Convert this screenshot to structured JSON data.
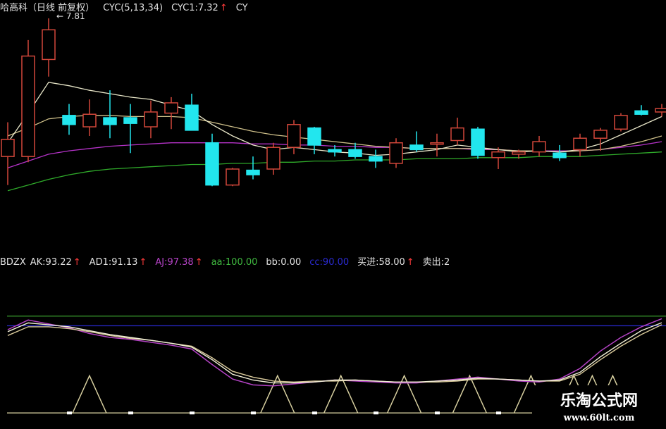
{
  "colors": {
    "background": "#000000",
    "up_candle": "#d2473a",
    "down_candle": "#22e6ee",
    "ma_fast": "#e8e6c8",
    "ma_mid": "#cfc08a",
    "ma_slow": "#b532c8",
    "ma_long": "#2faa2a",
    "ak_line": "#f2f0d8",
    "ad1_line": "#d8c99a",
    "aj_line": "#b543c6",
    "level_green": "#3aa02e",
    "level_blue": "#2a2ad0",
    "level_bottom": "#d8d0a0",
    "white_text": "#e0e0e0",
    "arrow": "#ff3b3b"
  },
  "top_header": {
    "title": "哈高科（日线 前复权）",
    "cyc_params": "CYC(5,13,34)",
    "cyc1": "CYC1:7.32",
    "cyc1_arrow": "↑",
    "cyc_trunc": "CY"
  },
  "price_annotation": "7.81",
  "indicator_header": {
    "name": "BDZX",
    "ak": "AK:93.22",
    "ak_arrow": "↑",
    "ad1": "AD1:91.13",
    "ad1_arrow": "↑",
    "aj": "AJ:97.38",
    "aj_arrow": "↑",
    "aa": "aa:100.00",
    "bb": "bb:0.00",
    "cc": "cc:90.00",
    "buy": "买进:58.00",
    "buy_arrow": "↑",
    "sell": "卖出:2"
  },
  "watermark": {
    "title": "乐淘公式网",
    "url": "www.60lt.com"
  },
  "chart_data": {
    "type": "candlestick",
    "candles": [
      {
        "o": 6.6,
        "h": 6.9,
        "l": 6.35,
        "c": 6.75
      },
      {
        "o": 6.6,
        "h": 7.62,
        "l": 6.55,
        "c": 7.48
      },
      {
        "o": 7.45,
        "h": 7.81,
        "l": 7.3,
        "c": 7.71
      },
      {
        "o": 6.96,
        "h": 7.06,
        "l": 6.79,
        "c": 6.88
      },
      {
        "o": 6.86,
        "h": 7.1,
        "l": 6.78,
        "c": 6.97
      },
      {
        "o": 6.94,
        "h": 7.18,
        "l": 6.76,
        "c": 6.88
      },
      {
        "o": 6.94,
        "h": 7.06,
        "l": 6.63,
        "c": 6.89
      },
      {
        "o": 6.86,
        "h": 7.09,
        "l": 6.76,
        "c": 6.99
      },
      {
        "o": 6.98,
        "h": 7.12,
        "l": 6.84,
        "c": 7.07
      },
      {
        "o": 7.05,
        "h": 7.15,
        "l": 6.88,
        "c": 6.83
      },
      {
        "o": 6.72,
        "h": 6.8,
        "l": 6.34,
        "c": 6.35
      },
      {
        "o": 6.35,
        "h": 6.5,
        "l": 6.34,
        "c": 6.49
      },
      {
        "o": 6.48,
        "h": 6.6,
        "l": 6.4,
        "c": 6.44
      },
      {
        "o": 6.49,
        "h": 6.72,
        "l": 6.44,
        "c": 6.68
      },
      {
        "o": 6.68,
        "h": 6.92,
        "l": 6.62,
        "c": 6.88
      },
      {
        "o": 6.85,
        "h": 6.86,
        "l": 6.62,
        "c": 6.7
      },
      {
        "o": 6.66,
        "h": 6.7,
        "l": 6.6,
        "c": 6.64
      },
      {
        "o": 6.66,
        "h": 6.72,
        "l": 6.58,
        "c": 6.6
      },
      {
        "o": 6.6,
        "h": 6.66,
        "l": 6.5,
        "c": 6.56
      },
      {
        "o": 6.54,
        "h": 6.76,
        "l": 6.5,
        "c": 6.72
      },
      {
        "o": 6.7,
        "h": 6.82,
        "l": 6.64,
        "c": 6.66
      },
      {
        "o": 6.71,
        "h": 6.8,
        "l": 6.6,
        "c": 6.72
      },
      {
        "o": 6.74,
        "h": 6.94,
        "l": 6.7,
        "c": 6.85
      },
      {
        "o": 6.84,
        "h": 6.86,
        "l": 6.58,
        "c": 6.61
      },
      {
        "o": 6.59,
        "h": 6.68,
        "l": 6.49,
        "c": 6.64
      },
      {
        "o": 6.62,
        "h": 6.66,
        "l": 6.58,
        "c": 6.64
      },
      {
        "o": 6.64,
        "h": 6.78,
        "l": 6.6,
        "c": 6.73
      },
      {
        "o": 6.63,
        "h": 6.7,
        "l": 6.56,
        "c": 6.59
      },
      {
        "o": 6.66,
        "h": 6.8,
        "l": 6.6,
        "c": 6.76
      },
      {
        "o": 6.76,
        "h": 6.85,
        "l": 6.65,
        "c": 6.83
      },
      {
        "o": 6.84,
        "h": 6.98,
        "l": 6.82,
        "c": 6.96
      },
      {
        "o": 7.0,
        "h": 7.05,
        "l": 6.96,
        "c": 6.97
      },
      {
        "o": 6.99,
        "h": 7.06,
        "l": 6.95,
        "c": 7.02
      }
    ],
    "ma_fast": [
      6.72,
      6.98,
      7.25,
      7.22,
      7.18,
      7.15,
      7.12,
      7.1,
      7.05,
      7.0,
      6.88,
      6.78,
      6.7,
      6.66,
      6.68,
      6.66,
      6.64,
      6.63,
      6.61,
      6.62,
      6.64,
      6.66,
      6.7,
      6.68,
      6.66,
      6.64,
      6.65,
      6.64,
      6.66,
      6.71,
      6.79,
      6.87,
      6.95
    ],
    "ma_mid": [
      6.78,
      6.85,
      6.93,
      6.95,
      6.96,
      6.96,
      6.95,
      6.95,
      6.95,
      6.94,
      6.9,
      6.86,
      6.82,
      6.79,
      6.77,
      6.75,
      6.73,
      6.71,
      6.69,
      6.68,
      6.67,
      6.67,
      6.67,
      6.67,
      6.66,
      6.65,
      6.65,
      6.64,
      6.65,
      6.66,
      6.69,
      6.73,
      6.78
    ],
    "ma_slow": [
      6.5,
      6.56,
      6.62,
      6.65,
      6.67,
      6.69,
      6.7,
      6.71,
      6.72,
      6.72,
      6.72,
      6.72,
      6.71,
      6.71,
      6.7,
      6.7,
      6.69,
      6.69,
      6.68,
      6.68,
      6.67,
      6.67,
      6.67,
      6.66,
      6.66,
      6.65,
      6.65,
      6.65,
      6.65,
      6.66,
      6.68,
      6.7,
      6.73
    ],
    "ma_long": [
      6.3,
      6.35,
      6.4,
      6.44,
      6.47,
      6.49,
      6.5,
      6.51,
      6.52,
      6.53,
      6.53,
      6.54,
      6.54,
      6.55,
      6.55,
      6.56,
      6.56,
      6.57,
      6.57,
      6.57,
      6.58,
      6.58,
      6.58,
      6.59,
      6.59,
      6.59,
      6.6,
      6.6,
      6.6,
      6.61,
      6.62,
      6.63,
      6.64
    ],
    "price_range": [
      6.28,
      7.86
    ],
    "indicator": {
      "ak": [
        84,
        93,
        91,
        89,
        85,
        81,
        78,
        75,
        72,
        68,
        55,
        40,
        34,
        31,
        31,
        32,
        34,
        34,
        33,
        32,
        32,
        33,
        34,
        36,
        35,
        34,
        33,
        34,
        42,
        58,
        72,
        85,
        93.22
      ],
      "ad1": [
        80,
        89,
        89,
        87,
        84,
        80,
        77,
        75,
        72,
        69,
        57,
        43,
        37,
        33,
        32,
        33,
        33,
        34,
        33,
        32,
        32,
        32,
        33,
        35,
        35,
        34,
        33,
        33,
        40,
        55,
        69,
        81,
        91.13
      ],
      "aj": [
        86,
        96,
        92,
        88,
        82,
        78,
        76,
        73,
        70,
        66,
        50,
        35,
        29,
        28,
        30,
        32,
        34,
        33,
        32,
        31,
        31,
        33,
        35,
        37,
        35,
        33,
        32,
        35,
        46,
        64,
        78,
        89,
        97.38
      ],
      "level_aa": 100,
      "level_cc": 90,
      "level_buy": 58,
      "level_bb": 0,
      "signal_peaks": [
        4,
        13.2,
        16.3,
        19.4,
        22.6,
        25.6,
        27.7,
        28.6,
        29.6
      ],
      "signal_height": 11,
      "dot_positions": [
        3,
        6,
        9,
        12,
        15,
        18,
        21,
        24,
        27
      ],
      "range": [
        -10,
        150
      ]
    }
  }
}
